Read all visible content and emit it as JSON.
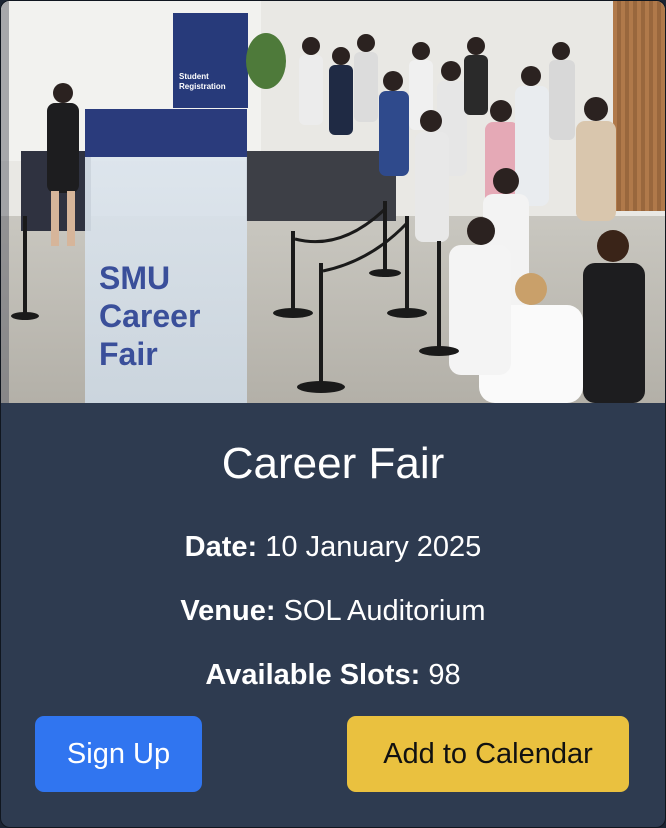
{
  "event": {
    "title": "Career Fair",
    "date_label": "Date:",
    "date_value": "10 January 2025",
    "venue_label": "Venue:",
    "venue_value": "SOL Auditorium",
    "slots_label": "Available Slots:",
    "slots_value": "98"
  },
  "photo": {
    "banner_text_line1": "SMU",
    "banner_text_line2": "Career",
    "banner_text_line3": "Fair",
    "sign_line1": "Student",
    "sign_line2": "Registration"
  },
  "actions": {
    "signup_label": "Sign Up",
    "calendar_label": "Add to Calendar"
  },
  "colors": {
    "card_background": "#2e3b50",
    "signup_button": "#3075f0",
    "calendar_button": "#eac13f"
  }
}
